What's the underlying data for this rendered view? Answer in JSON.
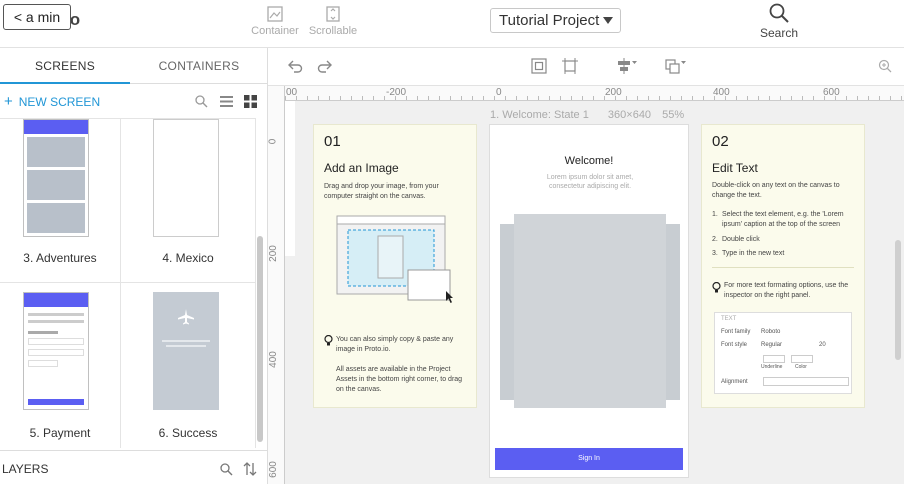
{
  "back_button": "< a min",
  "logo_fragment": "Io",
  "toolbar": {
    "container_label": "Container",
    "scrollable_label": "Scrollable",
    "project_name": "Tutorial Project",
    "search_label": "Search"
  },
  "left_panel": {
    "tabs": [
      "SCREENS",
      "CONTAINERS"
    ],
    "new_screen_label": "NEW SCREEN",
    "new_screen_icon": "+",
    "screens": [
      {
        "label": "3. Adventures"
      },
      {
        "label": "4. Mexico"
      },
      {
        "label": "5. Payment"
      },
      {
        "label": "6. Success"
      }
    ],
    "layers_label": "LAYERS"
  },
  "ruler": {
    "top_ticks": [
      "00",
      "-200",
      "0",
      "200",
      "400",
      "600"
    ],
    "left_ticks": [
      "0",
      "200",
      "400",
      "600"
    ]
  },
  "artboard": {
    "name": "1. Welcome: State 1",
    "size": "360×640",
    "zoom": "55%",
    "welcome_title": "Welcome!",
    "welcome_sub": "Lorem ipsum dolor sit amet, consectetur adipiscing elit.",
    "signin_label": "Sign In"
  },
  "card1": {
    "num": "01",
    "title": "Add an Image",
    "desc": "Drag and drop your image, from your computer straight on the canvas.",
    "tip1": "You can also simply copy & paste any image in Proto.io.",
    "tip2": "All assets are available in the Project Assets in the bottom right corner, to drag on the canvas."
  },
  "card2": {
    "num": "02",
    "title": "Edit Text",
    "desc": "Double-click on any text on the canvas to change the text.",
    "steps": [
      "Select the text element, e.g. the 'Lorem ipsum' caption at the top of the screen",
      "Double click",
      "Type in the new text"
    ],
    "tip": "For more text formating options, use the inspector on the right panel.",
    "inspector": {
      "section": "TEXT",
      "font_family_label": "Font family",
      "font_family_value": "Roboto",
      "font_style_label": "Font style",
      "font_style_value": "Regular",
      "font_size_value": "20",
      "underline_label": "Underline",
      "color_label": "Color",
      "alignment_label": "Alignment"
    }
  },
  "colors": {
    "accent": "#2196d6",
    "signin_button": "#5b5ef2",
    "card_bg": "#fbfbec",
    "canvas_bg": "#f0f0f0"
  }
}
